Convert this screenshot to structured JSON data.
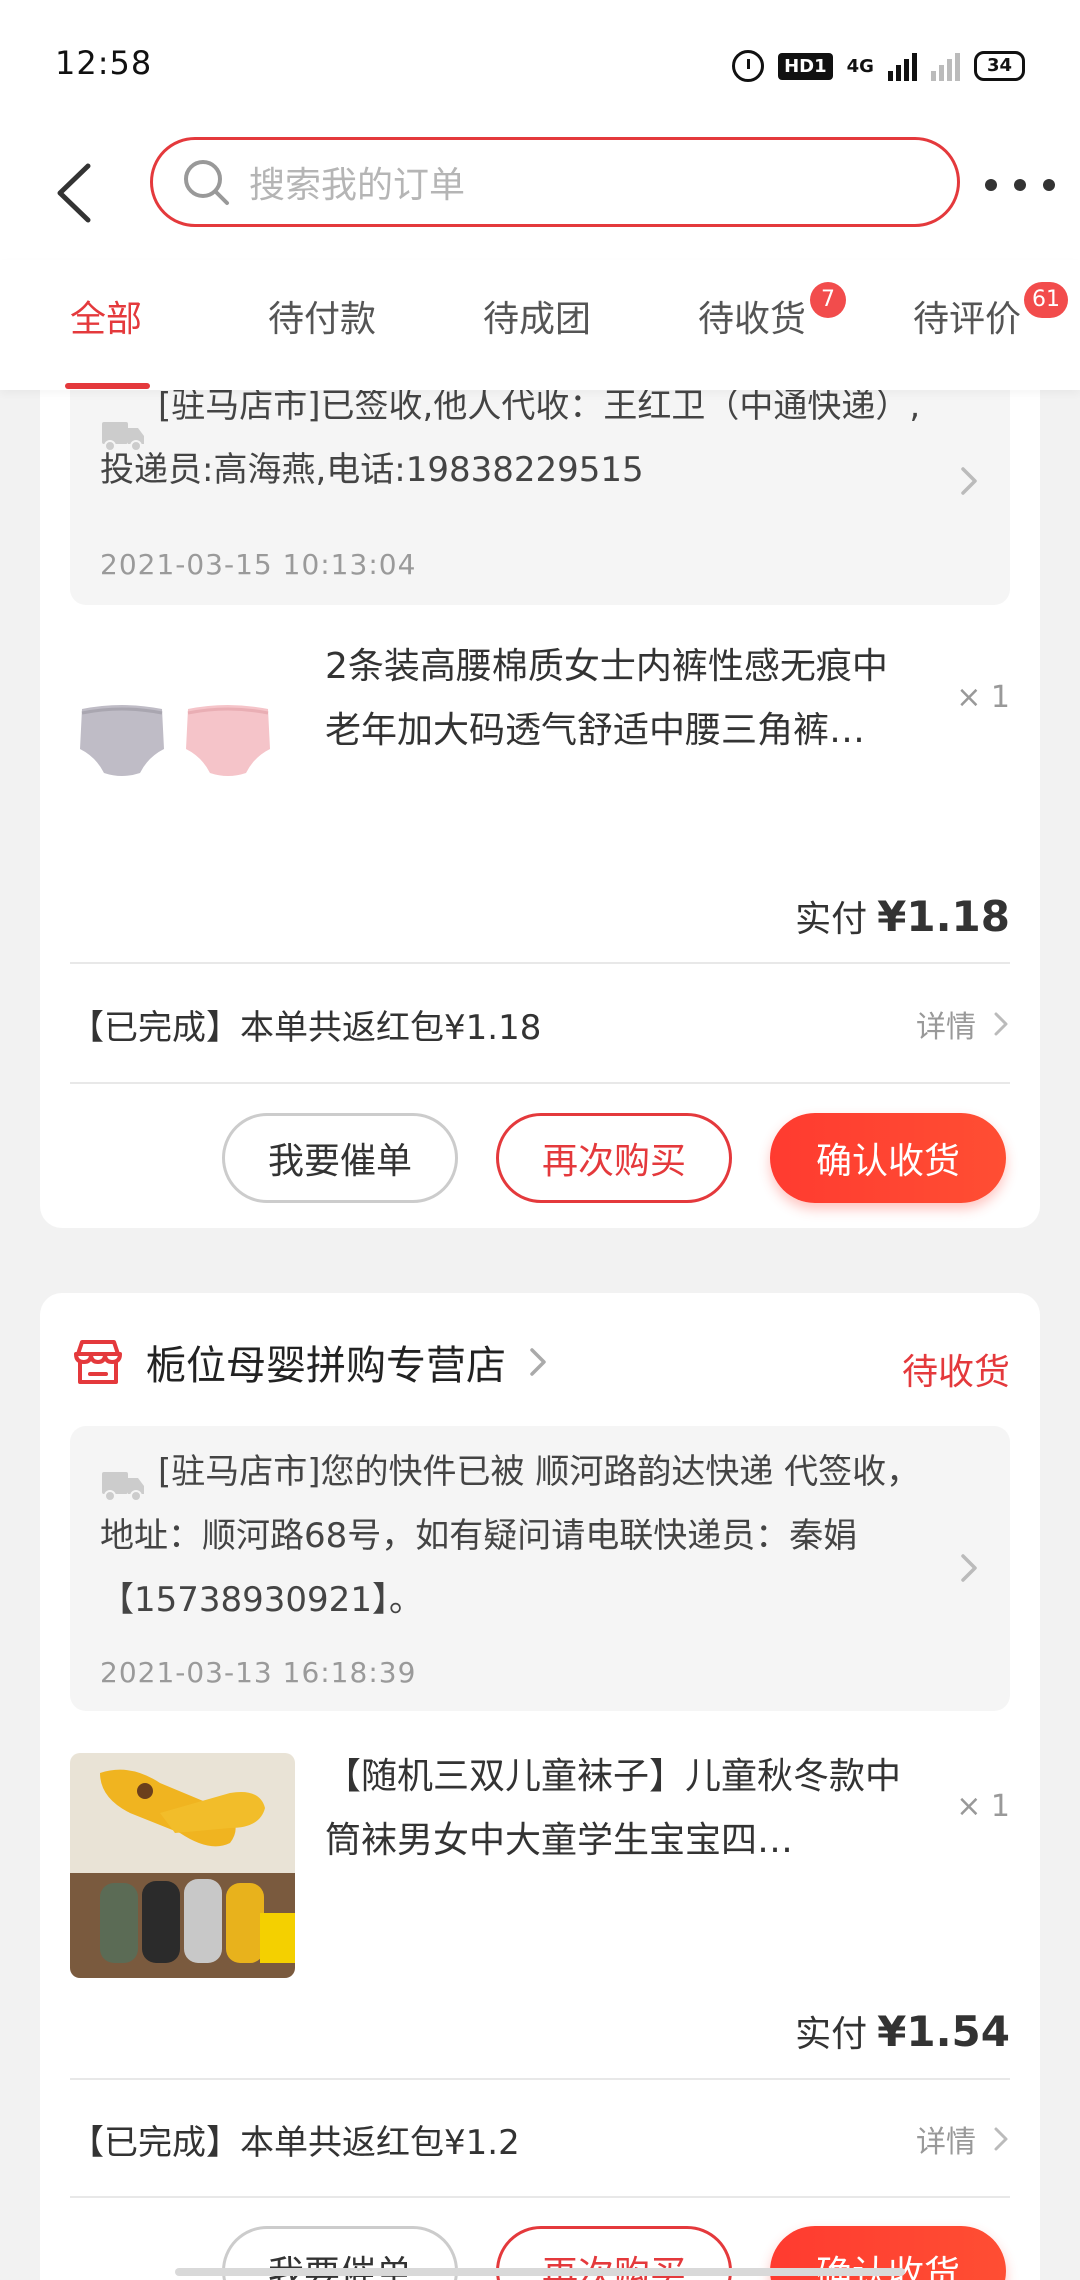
{
  "status_bar": {
    "time": "12:58",
    "hd_label": "HD1",
    "network_label": "4G",
    "battery": "34",
    "icons": [
      "alarm-icon",
      "hd-icon",
      "signal-icon",
      "signal-empty-icon",
      "battery-icon"
    ]
  },
  "header": {
    "search_placeholder": "搜索我的订单"
  },
  "tabs": [
    {
      "label": "全部",
      "active": true
    },
    {
      "label": "待付款"
    },
    {
      "label": "待成团"
    },
    {
      "label": "待收货",
      "badge": "7"
    },
    {
      "label": "待评价",
      "badge": "61"
    }
  ],
  "orders": [
    {
      "logistics_text": "[驻马店市]已签收,他人代收：王红卫（中通快递）,投递员:高海燕,电话:19838229515",
      "logistics_time": "2021-03-15 10:13:04",
      "product_title": "2条装高腰棉质女士内裤性感无痕中老年加大码透气舒适中腰三角裤…",
      "quantity": "× 1",
      "paid_label": "实付",
      "paid_amount": "¥1.18",
      "redpacket_text": "【已完成】本单共返红包¥1.18",
      "detail_label": "详情",
      "buttons": {
        "urge": "我要催单",
        "rebuy": "再次购买",
        "confirm": "确认收货"
      }
    },
    {
      "shop_name": "栀位母婴拼购专营店",
      "status": "待收货",
      "logistics_text": "[驻马店市]您的快件已被 顺河路韵达快递 代签收，地址：顺河路68号，如有疑问请电联快递员：秦娟 【15738930921】。",
      "logistics_time": "2021-03-13 16:18:39",
      "product_title": "【随机三双儿童袜子】儿童秋冬款中筒袜男女中大童学生宝宝四…",
      "quantity": "× 1",
      "paid_label": "实付",
      "paid_amount": "¥1.54",
      "redpacket_text": "【已完成】本单共返红包¥1.2",
      "detail_label": "详情",
      "buttons": {
        "urge": "我要催单",
        "rebuy": "再次购买",
        "confirm": "确认收货"
      }
    }
  ],
  "colors": {
    "accent": "#e4393c",
    "confirm_button": "#ff3b30",
    "background": "#f2f2f2"
  }
}
